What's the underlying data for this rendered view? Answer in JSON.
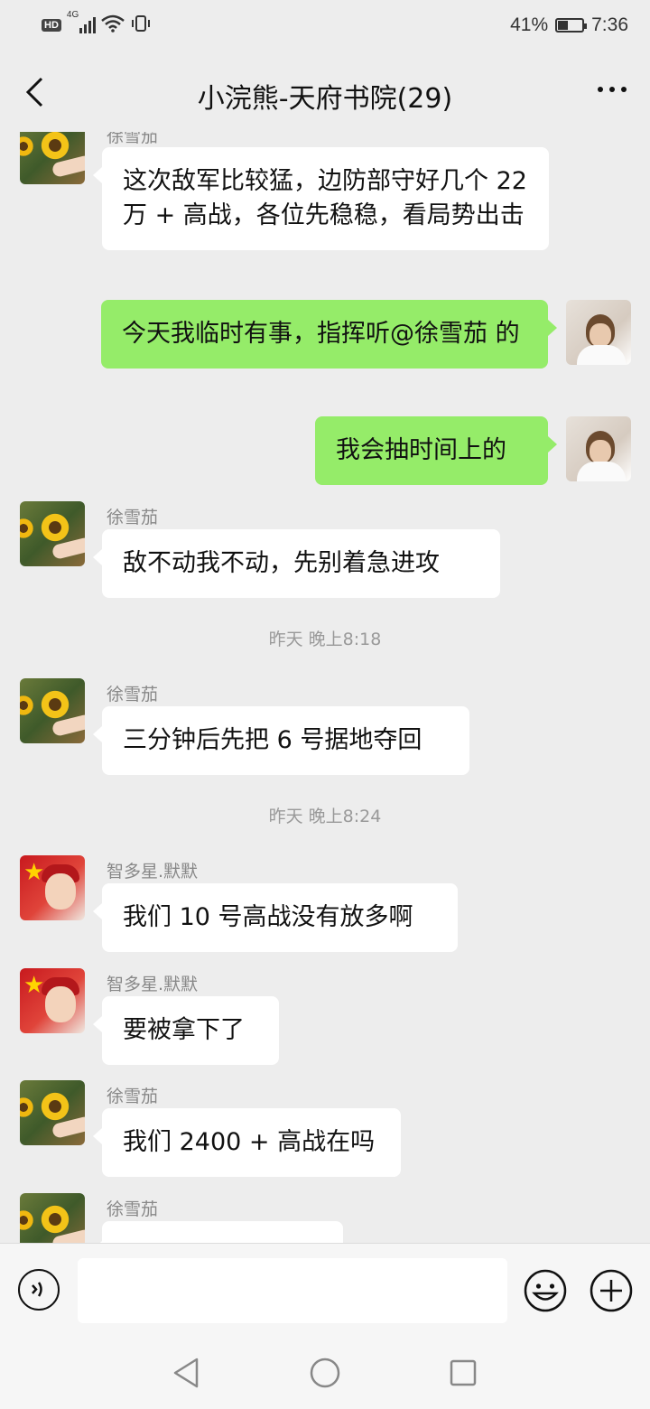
{
  "status_bar": {
    "network_label": "HD",
    "signal_label": "4G",
    "battery_percent": "41%",
    "battery_level": 0.41,
    "time": "7:36"
  },
  "header": {
    "title": "小浣熊-天府书院(29)"
  },
  "messages": [
    {
      "side": "left",
      "sender": "徐雪茄",
      "avatar": "sunflower",
      "text": "这次敌军比较猛，边防部守好几个 22 万 + 高战，各位先稳稳，看局势出击"
    },
    {
      "side": "right",
      "avatar": "self",
      "text": "今天我临时有事，指挥听@徐雪茄 的"
    },
    {
      "side": "right",
      "avatar": "self",
      "text": "我会抽时间上的"
    },
    {
      "side": "left",
      "sender": "徐雪茄",
      "avatar": "sunflower",
      "text": "敌不动我不动，先别着急进攻"
    },
    {
      "type": "time",
      "text": "昨天 晚上8:18"
    },
    {
      "side": "left",
      "sender": "徐雪茄",
      "avatar": "sunflower",
      "text": "三分钟后先把 6 号据地夺回"
    },
    {
      "type": "time",
      "text": "昨天 晚上8:24"
    },
    {
      "side": "left",
      "sender": "智多星.默默",
      "avatar": "red",
      "text": "我们 10 号高战没有放多啊"
    },
    {
      "side": "left",
      "sender": "智多星.默默",
      "avatar": "red",
      "text": "要被拿下了"
    },
    {
      "side": "left",
      "sender": "徐雪茄",
      "avatar": "sunflower",
      "text": "我们 2400 + 高战在吗"
    },
    {
      "side": "left",
      "sender": "徐雪茄",
      "avatar": "sunflower",
      "text": ""
    }
  ],
  "top_partial_sender": "徐雪茄",
  "input_bar": {
    "placeholder": ""
  },
  "icons": {
    "back": "chevron-left-icon",
    "more": "more-dots-icon",
    "voice": "voice-icon",
    "emoji": "emoji-icon",
    "plus": "plus-icon",
    "nav_back": "triangle-back-icon",
    "nav_home": "circle-home-icon",
    "nav_recent": "square-recent-icon"
  },
  "colors": {
    "background": "#ededed",
    "bubble_self": "#95ec69",
    "bubble_other": "#ffffff"
  }
}
